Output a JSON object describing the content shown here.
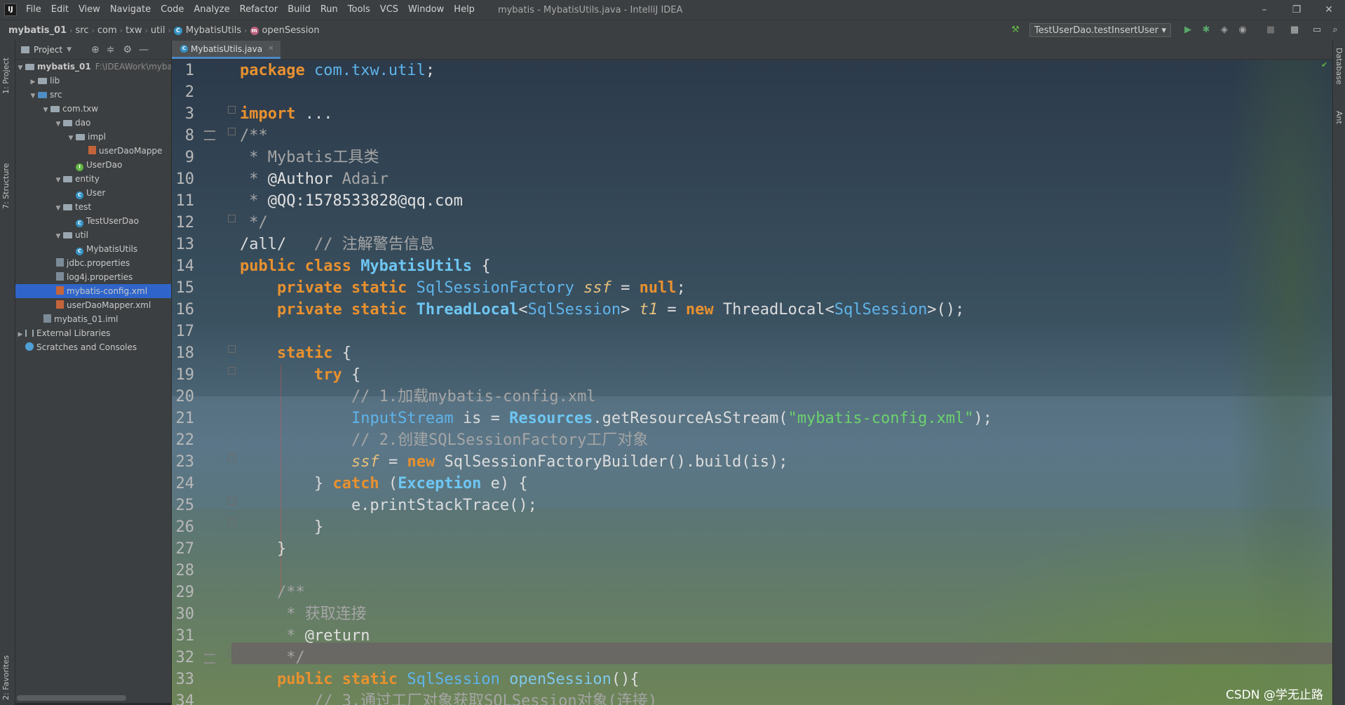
{
  "titlebar": {
    "menu": [
      "File",
      "Edit",
      "View",
      "Navigate",
      "Code",
      "Analyze",
      "Refactor",
      "Build",
      "Run",
      "Tools",
      "VCS",
      "Window",
      "Help"
    ],
    "window_title": "mybatis - MybatisUtils.java - IntelliJ IDEA",
    "controls": {
      "minimize": "–",
      "maximize": "❐",
      "close": "✕"
    }
  },
  "navbar": {
    "crumbs": [
      "mybatis_01",
      "src",
      "com",
      "txw",
      "util",
      "MybatisUtils",
      "openSession"
    ],
    "run_config": "TestUserDao.testInsertUser"
  },
  "left_stripe": {
    "project_tab": "1: Project",
    "structure_tab": "7: Structure",
    "favorites_tab": "2: Favorites"
  },
  "right_stripe": {
    "database_tab": "Database",
    "ant_tab": "Ant"
  },
  "project_panel": {
    "title": "Project",
    "tree": [
      {
        "label": "mybatis_01",
        "hint": "F:\\IDEAWork\\myba"
      },
      {
        "label": "lib"
      },
      {
        "label": "src"
      },
      {
        "label": "com.txw"
      },
      {
        "label": "dao"
      },
      {
        "label": "impl"
      },
      {
        "label": "userDaoMappe"
      },
      {
        "label": "UserDao"
      },
      {
        "label": "entity"
      },
      {
        "label": "User"
      },
      {
        "label": "test"
      },
      {
        "label": "TestUserDao"
      },
      {
        "label": "util"
      },
      {
        "label": "MybatisUtils"
      },
      {
        "label": "jdbc.properties"
      },
      {
        "label": "log4j.properties"
      },
      {
        "label": "mybatis-config.xml"
      },
      {
        "label": "userDaoMapper.xml"
      },
      {
        "label": "mybatis_01.iml"
      },
      {
        "label": "External Libraries"
      },
      {
        "label": "Scratches and Consoles"
      }
    ]
  },
  "editor": {
    "tab_label": "MybatisUtils.java",
    "line_numbers": [
      "1",
      "2",
      "3",
      "8",
      "9",
      "10",
      "11",
      "12",
      "13",
      "14",
      "15",
      "16",
      "17",
      "18",
      "19",
      "20",
      "21",
      "22",
      "23",
      "24",
      "25",
      "26",
      "27",
      "28",
      "29",
      "30",
      "31",
      "32",
      "33",
      "34"
    ],
    "code": {
      "l1_kw": "package ",
      "l1_pkg": "com.txw.util",
      "l1_end": ";",
      "l3_kw": "import ",
      "l3_rest": "...",
      "l8": "/**",
      "l9_star": " * ",
      "l9_text": "Mybatis工具类",
      "l10_star": " * ",
      "l10_tag": "@Author",
      "l10_val": " Adair",
      "l11_star": " * ",
      "l11_text": "@QQ:1578533828@qq.com",
      "l12": " */",
      "l13_code": "/all/",
      "l13_cm": "   // 注解警告信息",
      "l14_kw": "public class ",
      "l14_cls": "MybatisUtils",
      "l14_end": " {",
      "l15_kw": "    private static ",
      "l15_type": "SqlSessionFactory",
      "l15_var": " ssf",
      "l15_eq": " = ",
      "l15_null": "null",
      "l15_end": ";",
      "l16_kw": "    private static ",
      "l16_type": "ThreadLocal",
      "l16_lt": "<",
      "l16_gen": "SqlSession",
      "l16_gt": ">",
      "l16_var": " t1",
      "l16_eq": " = ",
      "l16_new": "new",
      "l16_rest": " ThreadLocal<",
      "l16_gen2": "SqlSession",
      "l16_tail": ">();",
      "l18_kw": "    static",
      "l18_end": " {",
      "l19_kw": "        try",
      "l19_end": " {",
      "l20": "            // 1.加载mybatis-config.xml",
      "l21_pre": "            ",
      "l21_type": "InputStream",
      "l21_var": " is = ",
      "l21_cls": "Resources",
      "l21_call": ".getResourceAsStream(",
      "l21_str": "\"mybatis-config.xml\"",
      "l21_end": ");",
      "l22": "            // 2.创建SQLSessionFactory工厂对象",
      "l23_pre": "            ",
      "l23_var": "ssf",
      "l23_eq": " = ",
      "l23_new": "new",
      "l23_rest": " SqlSessionFactoryBuilder().build(is);",
      "l24_pre": "        } ",
      "l24_kw": "catch",
      "l24_mid": " (",
      "l24_cls": "Exception",
      "l24_end": " e) {",
      "l25": "            e.printStackTrace();",
      "l26": "        }",
      "l27": "    }",
      "l29": "    /**",
      "l30_star": "     * ",
      "l30_text": "获取连接",
      "l31_star": "     * ",
      "l31_tag": "@return",
      "l32": "     */",
      "l33_kw": "    public static ",
      "l33_type": "SqlSession",
      "l33_fn": " openSession",
      "l33_end": "(){",
      "l34": "        // 3.通过工厂对象获取SQLSession对象(连接)"
    }
  },
  "watermark": "CSDN @学无止路",
  "colors": {
    "keyword": "#e8912f",
    "type": "#5fb4ea",
    "string": "#6cd36c",
    "comment": "#a5a5a5",
    "selection": "#2f65ca"
  }
}
